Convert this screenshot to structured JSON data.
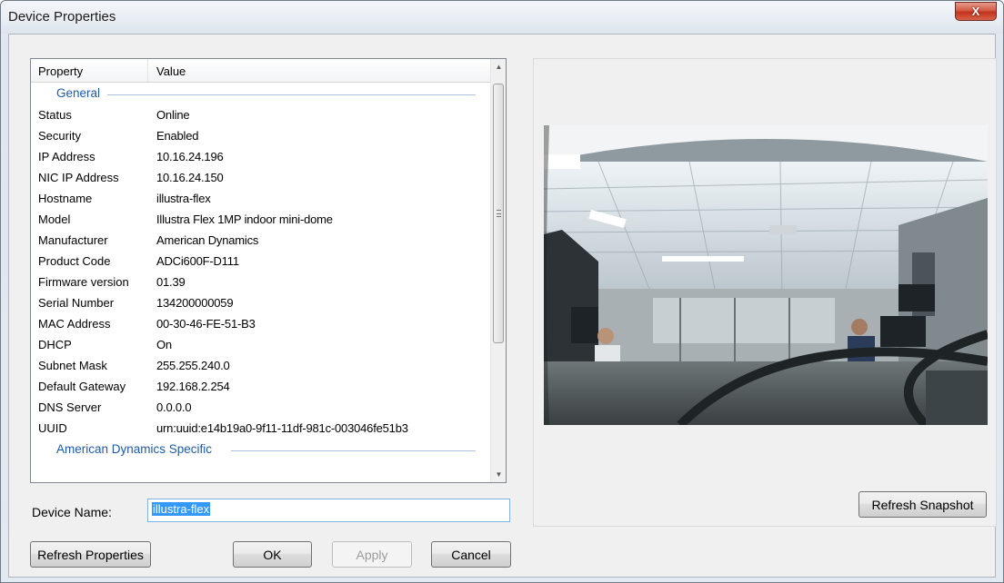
{
  "window": {
    "title": "Device Properties",
    "close_glyph": "X"
  },
  "property_list": {
    "headers": {
      "property": "Property",
      "value": "Value"
    },
    "groups": [
      {
        "label": "General",
        "rows": [
          {
            "name": "Status",
            "value": "Online"
          },
          {
            "name": "Security",
            "value": "Enabled"
          },
          {
            "name": "IP Address",
            "value": "10.16.24.196"
          },
          {
            "name": "NIC IP Address",
            "value": "10.16.24.150"
          },
          {
            "name": "Hostname",
            "value": "illustra-flex"
          },
          {
            "name": "Model",
            "value": "Illustra Flex 1MP indoor mini-dome"
          },
          {
            "name": "Manufacturer",
            "value": "American Dynamics"
          },
          {
            "name": "Product Code",
            "value": "ADCi600F-D111"
          },
          {
            "name": "Firmware version",
            "value": "01.39"
          },
          {
            "name": "Serial Number",
            "value": "134200000059"
          },
          {
            "name": "MAC Address",
            "value": "00-30-46-FE-51-B3"
          },
          {
            "name": "DHCP",
            "value": "On"
          },
          {
            "name": "Subnet Mask",
            "value": "255.255.240.0"
          },
          {
            "name": "Default Gateway",
            "value": "192.168.2.254"
          },
          {
            "name": "DNS Server",
            "value": "0.0.0.0"
          },
          {
            "name": "UUID",
            "value": "urn:uuid:e14b19a0-9f11-11df-981c-003046fe51b3"
          }
        ]
      },
      {
        "label": "American Dynamics Specific",
        "rows": []
      }
    ]
  },
  "device_name": {
    "label": "Device Name:",
    "value": "illustra-flex"
  },
  "buttons": {
    "refresh_properties": "Refresh Properties",
    "ok": "OK",
    "apply": "Apply",
    "cancel": "Cancel",
    "refresh_snapshot": "Refresh Snapshot"
  },
  "snapshot": {
    "description_icon": "camera-snapshot-image"
  },
  "colors": {
    "group_label": "#1e5aa8",
    "selection": "#3399ff",
    "close_button": "#c2321d"
  }
}
